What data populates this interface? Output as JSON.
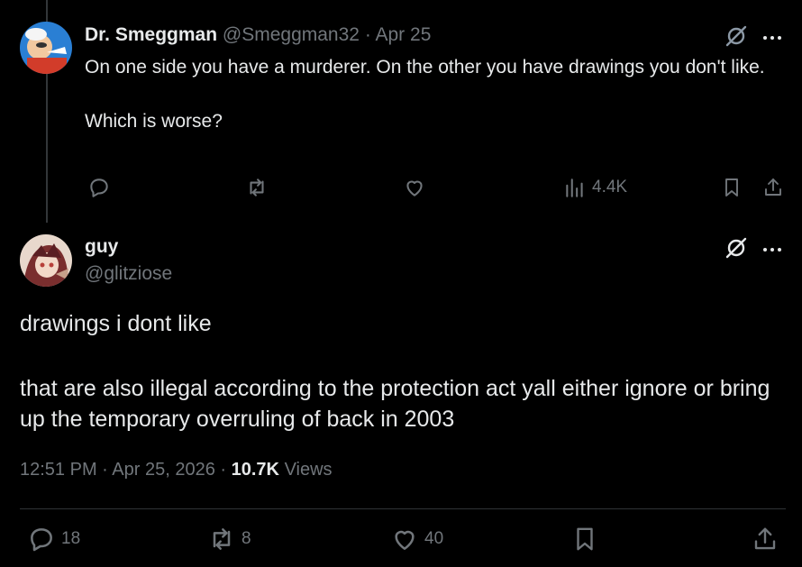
{
  "parent_tweet": {
    "author_name": "Dr. Smeggman",
    "handle": "@Smeggman32",
    "separator": "·",
    "date": "Apr 25",
    "text_line1": "On one side you have a murderer. On the other you have drawings you don't like.",
    "text_line2": "Which is worse?",
    "views": "4.4K"
  },
  "main_tweet": {
    "author_name": "guy",
    "handle": "@glitziose",
    "text_line1": "drawings i dont like",
    "text_line2": "that are also illegal according to the protection act yall either ignore or bring up the temporary overruling of back in 2003",
    "time": "12:51 PM",
    "date": "Apr 25, 2026",
    "separator": "·",
    "views_count": "10.7K",
    "views_label": "Views",
    "replies": "18",
    "reposts": "8",
    "likes": "40"
  },
  "colors": {
    "background": "#000000",
    "text": "#e7e9ea",
    "muted": "#71767b",
    "divider": "#2f3336"
  },
  "icons": [
    "reply-icon",
    "repost-icon",
    "like-icon",
    "views-icon",
    "bookmark-icon",
    "share-icon",
    "grok-icon",
    "more-icon"
  ]
}
